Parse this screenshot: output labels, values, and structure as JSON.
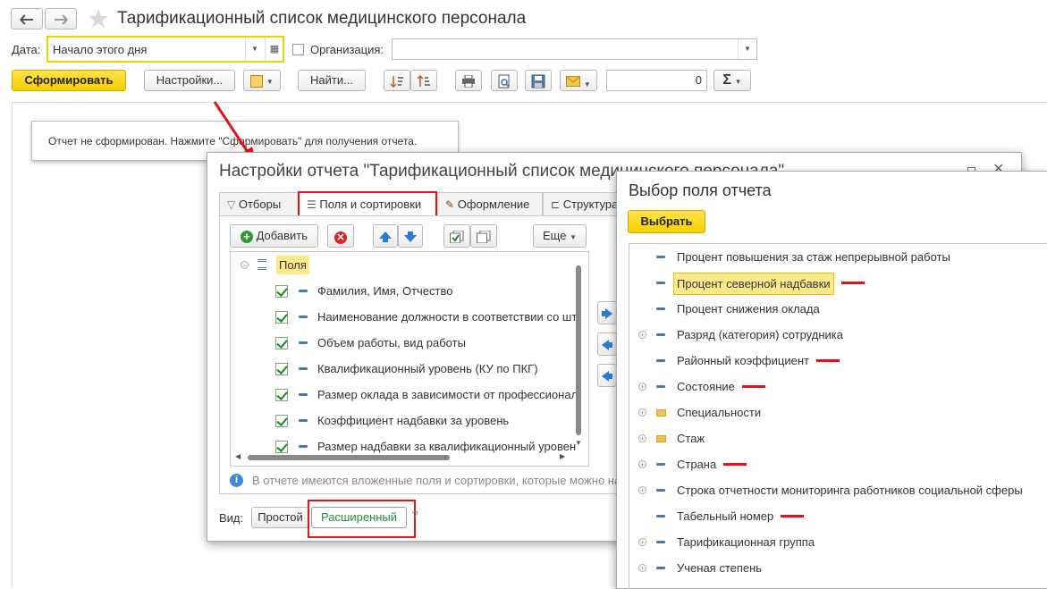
{
  "window": {
    "title": "Тарификационный список медицинского персонала"
  },
  "filters": {
    "date_label": "Дата:",
    "date_value": "Начало этого дня",
    "org_label": "Организация:",
    "org_value": ""
  },
  "toolbar": {
    "form_label": "Сформировать",
    "settings_label": "Настройки...",
    "find_label": "Найти...",
    "sum_value": "0",
    "sigma": "Σ"
  },
  "report_msg": "Отчет не сформирован. Нажмите \"Сформировать\" для получения отчета.",
  "settings_dialog": {
    "title": "Настройки отчета \"Тарификационный список медицинского персонала\"",
    "tabs": [
      {
        "label": "Отборы"
      },
      {
        "label": "Поля и сортировки"
      },
      {
        "label": "Оформление"
      },
      {
        "label": "Структура"
      }
    ],
    "add_label": "Добавить",
    "more_label": "Еще",
    "root_label": "Поля",
    "fields": [
      {
        "label": "Фамилия, Имя, Отчество"
      },
      {
        "label": "Наименование должности в соответствии со шт"
      },
      {
        "label": "Объем работы, вид работы"
      },
      {
        "label": "Квалификационный уровень (КУ по ПКГ)"
      },
      {
        "label": "Размер оклада в зависимости от профессионал"
      },
      {
        "label": "Коэффициент надбавки за уровень"
      },
      {
        "label": "Размер надбавки за квалификационный уровен"
      }
    ],
    "info_text": "В отчете имеются вложенные поля и сортировки, которые можно на",
    "view_label": "Вид:",
    "view_simple": "Простой",
    "view_extended": "Расширенный",
    "help": "?"
  },
  "field_picker": {
    "title": "Выбор поля отчета",
    "select_label": "Выбрать",
    "items": [
      {
        "label": "Процент повышения за стаж непрерывной работы",
        "expandable": false,
        "folder": false,
        "selected": false,
        "marked": false
      },
      {
        "label": "Процент северной надбавки",
        "expandable": false,
        "folder": false,
        "selected": true,
        "marked": true
      },
      {
        "label": "Процент снижения оклада",
        "expandable": false,
        "folder": false,
        "selected": false,
        "marked": false
      },
      {
        "label": "Разряд (категория) сотрудника",
        "expandable": true,
        "folder": false,
        "selected": false,
        "marked": false
      },
      {
        "label": "Районный коэффициент",
        "expandable": false,
        "folder": false,
        "selected": false,
        "marked": true
      },
      {
        "label": "Состояние",
        "expandable": true,
        "folder": false,
        "selected": false,
        "marked": true
      },
      {
        "label": "Специальности",
        "expandable": true,
        "folder": true,
        "selected": false,
        "marked": false
      },
      {
        "label": "Стаж",
        "expandable": true,
        "folder": true,
        "selected": false,
        "marked": false
      },
      {
        "label": "Страна",
        "expandable": true,
        "folder": false,
        "selected": false,
        "marked": true
      },
      {
        "label": "Строка отчетности мониторинга работников социальной сферы",
        "expandable": true,
        "folder": false,
        "selected": false,
        "marked": false
      },
      {
        "label": "Табельный номер",
        "expandable": false,
        "folder": false,
        "selected": false,
        "marked": true
      },
      {
        "label": "Тарификационная группа",
        "expandable": true,
        "folder": false,
        "selected": false,
        "marked": false
      },
      {
        "label": "Ученая степень",
        "expandable": true,
        "folder": false,
        "selected": false,
        "marked": false
      }
    ]
  },
  "colors": {
    "accent_yellow": "#f5cf00",
    "annotation_red": "#e0141a",
    "selected_bg": "#fde98a"
  }
}
